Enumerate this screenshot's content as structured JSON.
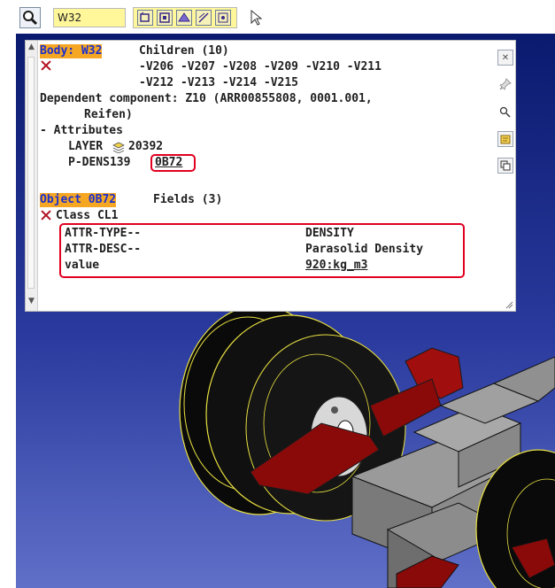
{
  "toolbar": {
    "search_value": "W32"
  },
  "panel": {
    "body_label": "Body: W32",
    "children_label": "Children (10)",
    "children_line1": "-V206 -V207 -V208 -V209 -V210 -V211",
    "children_line2": "-V212 -V213 -V214 -V215",
    "dependent_line1": "Dependent component: Z10 (ARR00855808, 0001.001,",
    "dependent_line2": "Reifen)",
    "attributes_label": "- Attributes",
    "layer_label": "LAYER",
    "layer_value": "20392",
    "pdens_label": "P-DENS139",
    "pdens_value": "0B72",
    "object_label": "Object 0B72",
    "fields_label": "Fields (3)",
    "class_label": "Class CL1",
    "fields": [
      {
        "key": "ATTR-TYPE--",
        "value": "DENSITY"
      },
      {
        "key": "ATTR-DESC--",
        "value": "Parasolid Density"
      },
      {
        "key": "value",
        "value": "920:kg_m3"
      }
    ]
  },
  "colors": {
    "highlight": "#f5a623",
    "accent_red": "#e00020",
    "viewport_top": "#0a1a6e",
    "viewport_bottom": "#6070c8"
  },
  "icons": [
    "magnifier-icon",
    "pointer-icon",
    "close-icon",
    "pin-icon",
    "zoom-icon",
    "note-icon",
    "copy-icon",
    "layer-icon"
  ]
}
